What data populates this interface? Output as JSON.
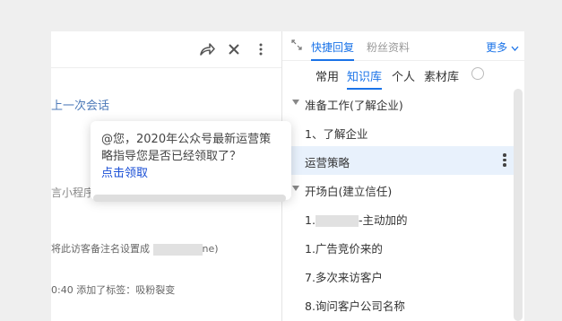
{
  "left": {
    "last_session": "上一次会话",
    "mini_program": "言小程序",
    "note_prefix": "将此访客备注名设置成",
    "note_suffix": "ne)",
    "tag_time": "0:40",
    "tag_text": "添加了标签：吸粉裂变"
  },
  "popup": {
    "message": "@您，2020年公众号最新运营策略指导您是否已经领取了？",
    "link": "点击领取"
  },
  "right": {
    "tabs": [
      "快捷回复",
      "粉丝资料"
    ],
    "more": "更多",
    "subtabs": [
      "常用",
      "知识库",
      "个人",
      "素材库"
    ],
    "items": [
      {
        "label": "准备工作(了解企业)",
        "group": true
      },
      {
        "label": "1、了解企业",
        "group": false
      },
      {
        "label": "运营策略",
        "group": false,
        "selected": true
      },
      {
        "label": "开场白(建立信任)",
        "group": true
      },
      {
        "label": "-主动加的",
        "prefix": "1.",
        "group": false
      },
      {
        "label": "1.广告竞价来的",
        "group": false
      },
      {
        "label": "7.多次来访客户",
        "group": false
      },
      {
        "label": "8.询问客户公司名称",
        "group": false
      }
    ]
  }
}
